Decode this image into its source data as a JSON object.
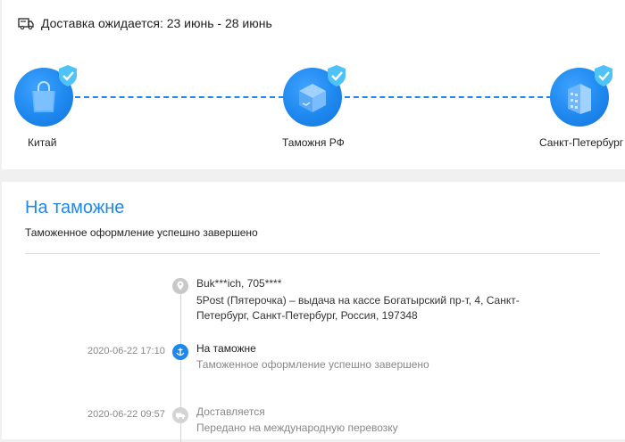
{
  "delivery": {
    "text": "Доставка ожидается: 23 июнь - 28 июнь",
    "icon": "delivery-truck-icon"
  },
  "stages": [
    {
      "label": "Китай",
      "icon": "shopping-bag-icon"
    },
    {
      "label": "Таможня РФ",
      "icon": "package-box-icon"
    },
    {
      "label": "Санкт-Петербург",
      "icon": "building-icon"
    }
  ],
  "status": {
    "title": "На таможне",
    "subtitle": "Таможенное оформление успешно завершено"
  },
  "address": {
    "line1": "Buk***ich,  705****",
    "line2": "5Post (Пятерочка) – выдача на кассе Богатырский пр-т, 4,  Санкт-Петербург,  Санкт-Петербург,  Россия,  197348"
  },
  "events": [
    {
      "date": "2020-06-22 17:10",
      "title": "На таможне",
      "desc": "Таможенное оформление успешно завершено",
      "active": true
    },
    {
      "date": "2020-06-22 09:57",
      "title": "Доставляется",
      "desc": "Передано на международную перевозку",
      "active": false
    }
  ],
  "colors": {
    "accent": "#1e88ef",
    "check": "#4fc3f7",
    "muted": "#888888"
  }
}
